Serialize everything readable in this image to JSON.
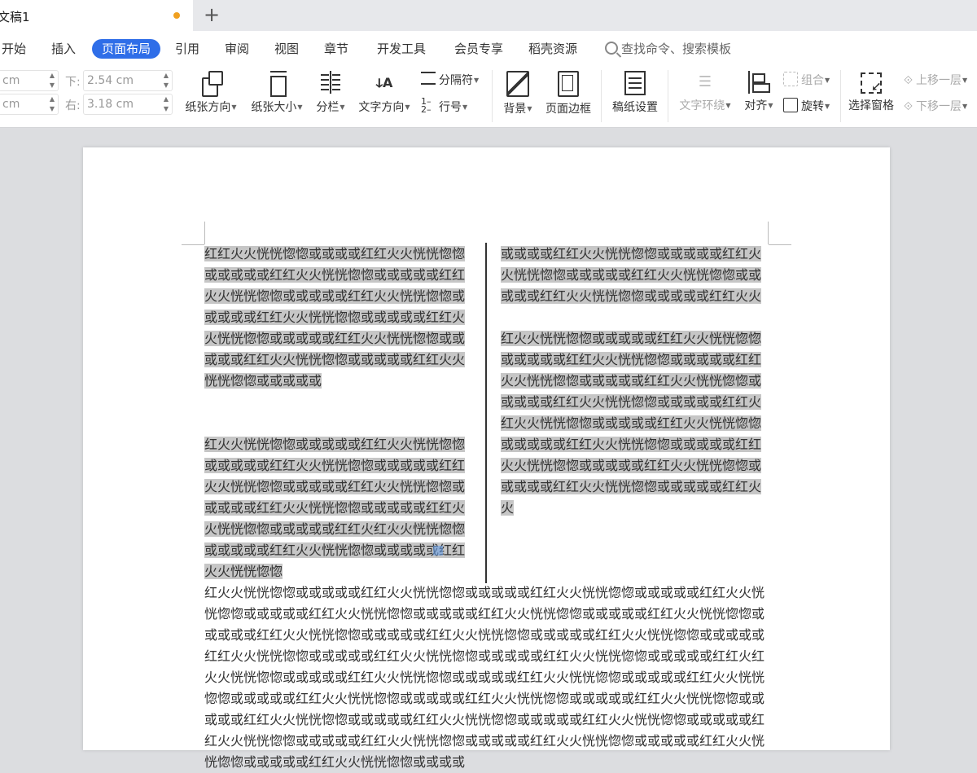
{
  "tabbar": {
    "doc_title": "文稿1",
    "new_tab_label": "+"
  },
  "menu": {
    "items": [
      "开始",
      "插入",
      "页面布局",
      "引用",
      "审阅",
      "视图",
      "章节",
      "开发工具",
      "会员专享",
      "稻壳资源"
    ],
    "active": "页面布局",
    "search_placeholder": "查找命令、搜索模板"
  },
  "ribbon": {
    "margins": {
      "top_unit": "cm",
      "left_unit": "cm",
      "bottom_label": "下:",
      "bottom_value": "2.54 cm",
      "right_label": "右:",
      "right_value": "3.18 cm"
    },
    "buttons": {
      "orientation": "纸张方向",
      "size": "纸张大小",
      "columns": "分栏",
      "text_direction": "文字方向",
      "separator": "分隔符",
      "line_number": "行号",
      "background": "背景",
      "page_border": "页面边框",
      "grid_paper": "稿纸设置",
      "text_wrap": "文字环绕",
      "align": "对齐",
      "group": "组合",
      "rotate": "旋转",
      "selection_pane": "选择窗格",
      "bring_forward": "上移一层",
      "send_backward": "下移一层"
    },
    "text_dir_glyph": "ↆA"
  },
  "document": {
    "left_col": {
      "p1": "红红火火恍恍惚惚或或或或红红火火恍恍惚惚或或或或或红红火火恍恍惚惚或或或或或红红火火恍恍惚惚或或或或或红红火火恍恍惚惚或或或或或红红火火恍恍惚惚或或或或或红红火火恍恍惚惚或或或或或红红火火恍恍惚惚或或或或或红红火火恍恍惚惚或或或或或红红火火恍恍惚惚或或或或或",
      "p2": "红火火恍恍惚惚或或或或或红红火火恍恍惚惚或或或或或红红火火恍恍惚惚或或或或或红红火火恍恍惚惚或或或或或红红火火恍恍惚惚或或或或或红红火火恍恍惚惚或或或或或红红火火恍恍惚惚或或或或或红红火红火火恍恍惚惚或或或或或红红火火恍恍惚惚或或或或或红红火火恍恍惚惚"
    },
    "right_col": {
      "p1": "或或或或红红火火恍恍惚惚或或或或或红红火火恍恍惚惚或或或或或红红火火恍恍惚惚或或或或或红红火火恍恍惚惚或或或或或红红火火",
      "p2": "红火火恍恍惚惚或或或或或红红火火恍恍惚惚或或或或或红红火火恍恍惚惚或或或或或红红火火恍恍惚惚或或或或或红红火火恍恍惚惚或或或或或红红火火恍恍惚惚或或或或或红红火红火火恍恍惚惚或或或或或红红火火恍恍惚惚或或或或或红红火火恍恍惚惚或或或或或红红火火恍恍惚惚或或或或或红红火火恍恍惚惚或或或或或红红火火恍恍惚惚或或或或或红红火火"
    },
    "body": "红火火恍恍惚惚或或或或或红红火火恍恍惚惚或或或或或红红火火恍恍惚惚或或或或或红红火火恍恍惚惚或或或或或红红火火恍恍惚惚或或或或或红红火火恍恍惚惚或或或或或红红火火恍恍惚惚或或或或或红红火火恍恍惚惚或或或或或红红火火恍恍惚惚或或或或或红红火火恍恍惚惚或或或或或红红火火恍恍惚惚或或或或或红红火火恍恍惚惚或或或或或红红火火恍恍惚惚或或或或或红红火红火火恍恍惚惚或或或或或红红火火恍恍惚惚或或或或或红红火火恍恍惚惚或或或或或红红火火恍恍惚惚或或或或或红红火火恍恍惚惚或或或或或红红火火恍恍惚惚或或或或或红红火火恍恍惚惚或或或或或红红火火恍恍惚惚或或或或或红红火火恍恍惚惚或或或或或红红火火恍恍惚惚或或或或或红红火火恍恍惚惚或或或或或红红火火恍恍惚惚或或或或或红红火火恍恍惚惚或或或或或红红火火恍恍惚惚或或或或或红红火火恍恍惚惚或或或或"
  },
  "colors": {
    "accent": "#2f6ee8",
    "selection": "#c6c6c6",
    "unsaved_dot": "#f0a020"
  }
}
